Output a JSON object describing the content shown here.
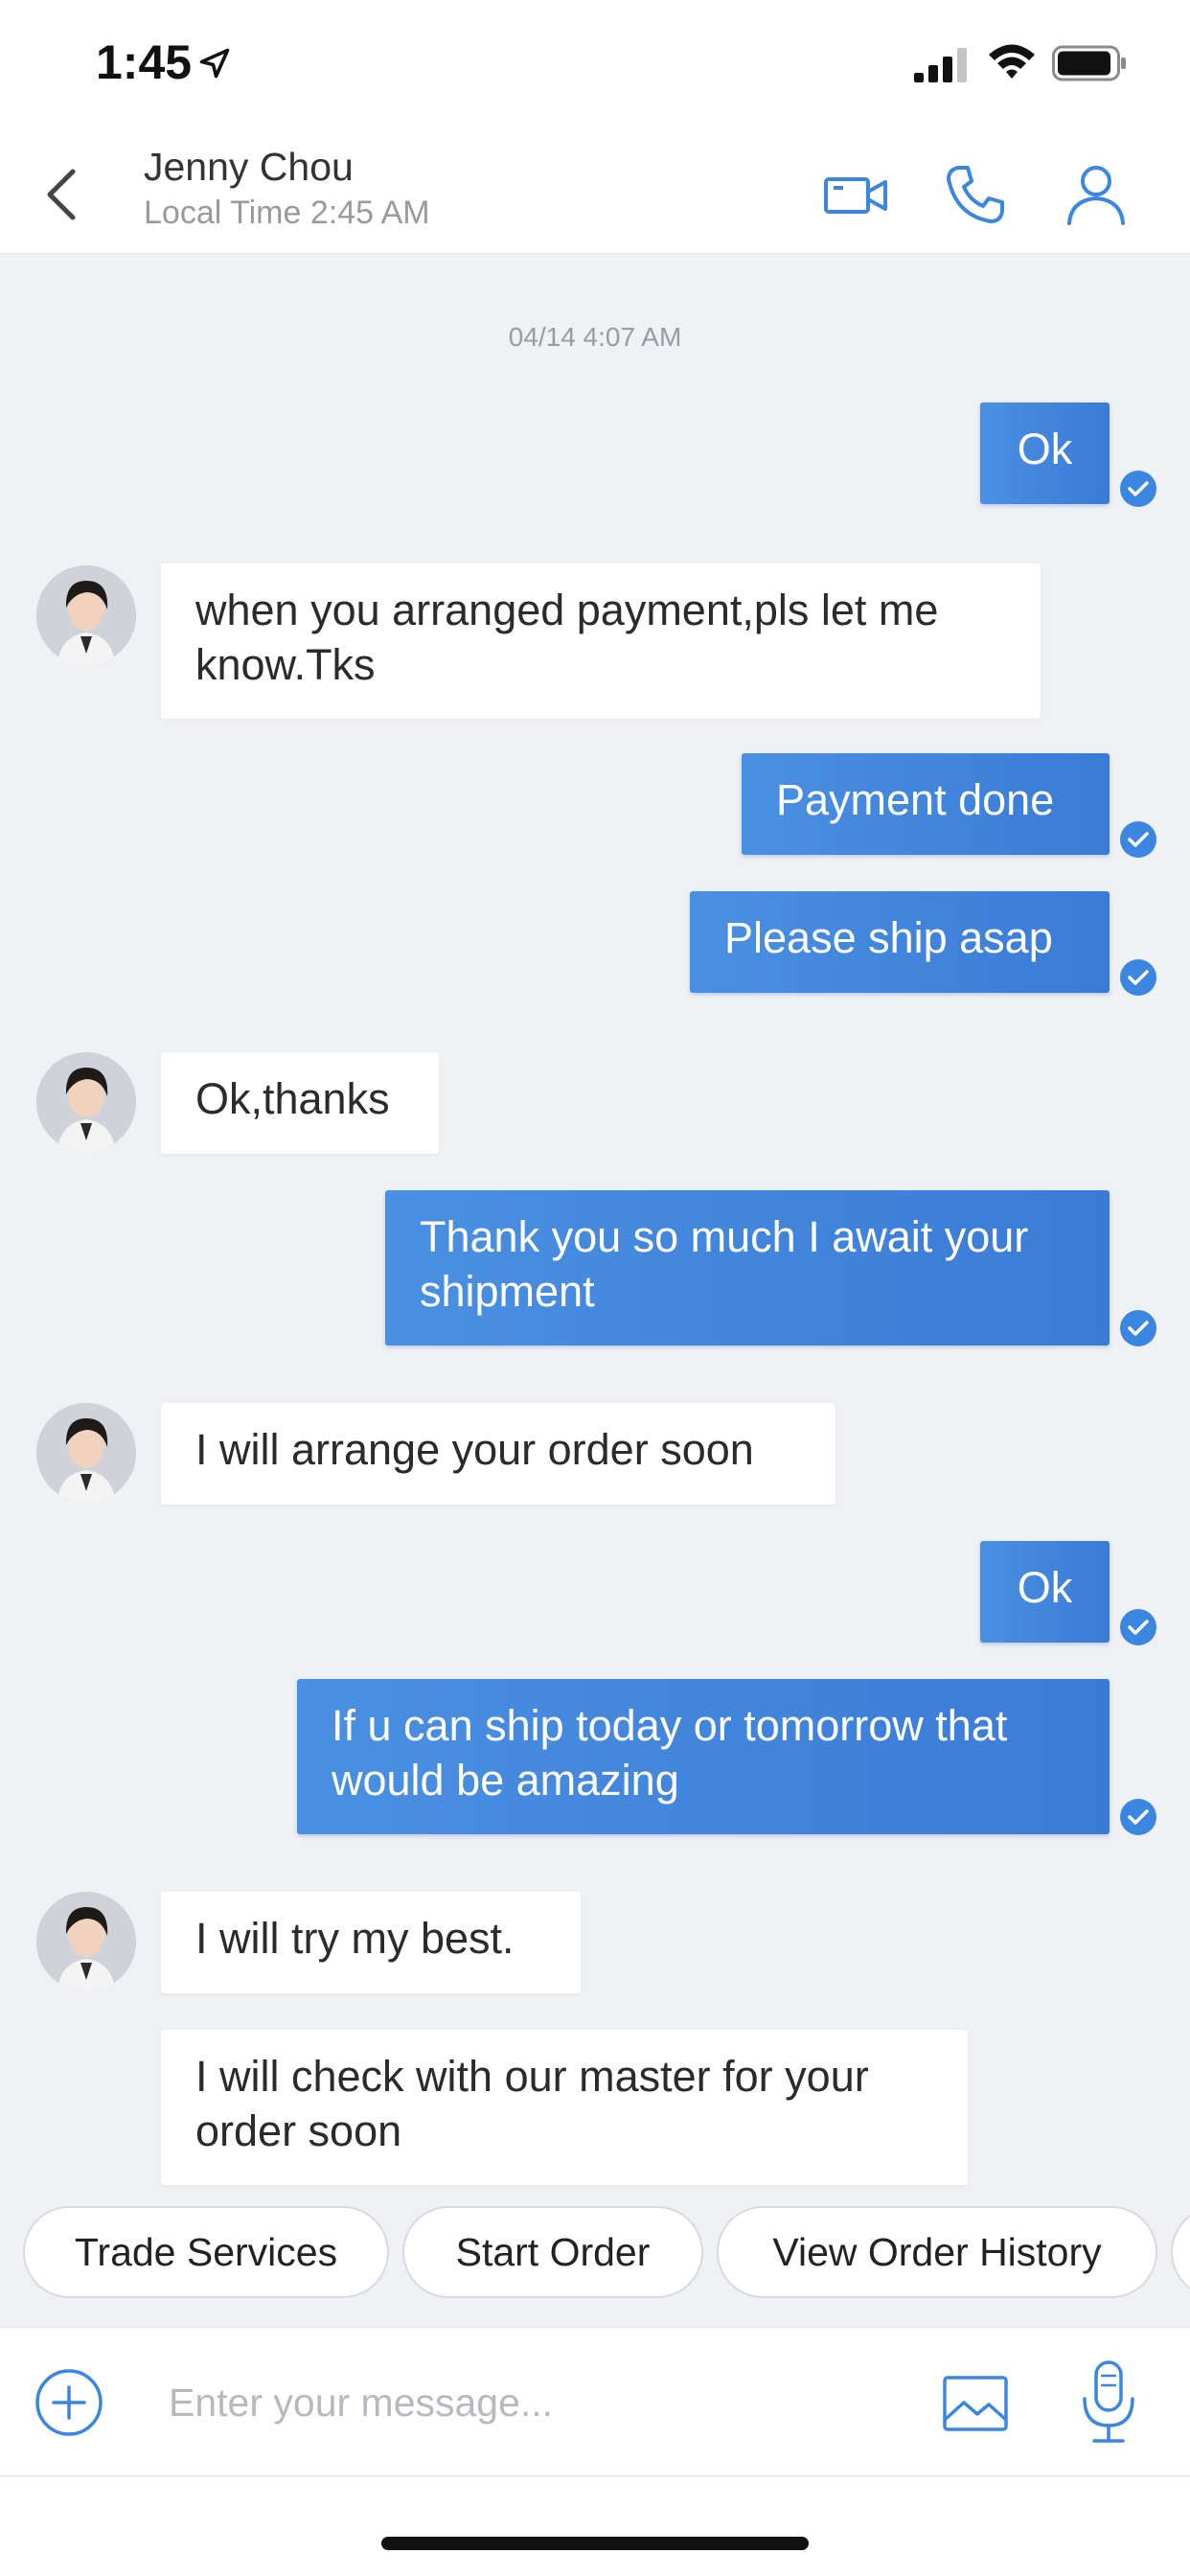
{
  "status_bar": {
    "time": "1:45"
  },
  "header": {
    "contact_name": "Jenny Chou",
    "local_time": "Local Time 2:45 AM"
  },
  "chat": {
    "timestamp": "04/14 4:07 AM",
    "messages": [
      {
        "side": "out",
        "text": "Ok",
        "read": true
      },
      {
        "side": "in",
        "text": "when you arranged payment,pls let me know.Tks"
      },
      {
        "side": "out",
        "text": "Payment done",
        "read": true
      },
      {
        "side": "out",
        "text": "Please ship asap",
        "read": true
      },
      {
        "side": "in",
        "text": "Ok,thanks"
      },
      {
        "side": "out",
        "text": "Thank you so much I await your shipment",
        "read": true
      },
      {
        "side": "in",
        "text": "I will arrange your order soon"
      },
      {
        "side": "out",
        "text": "Ok",
        "read": true
      },
      {
        "side": "out",
        "text": "If u can ship today or tomorrow that would be amazing",
        "read": true
      },
      {
        "side": "in",
        "text": "I will try my best."
      },
      {
        "side": "in",
        "text": "I will check with our master for your order soon"
      }
    ]
  },
  "quick_actions": [
    "Trade Services",
    "Start Order",
    "View Order History"
  ],
  "composer": {
    "placeholder": "Enter your message..."
  },
  "colors": {
    "accent": "#3a86e0",
    "bubble_out": "#4189df",
    "background": "#f0f1f5"
  }
}
